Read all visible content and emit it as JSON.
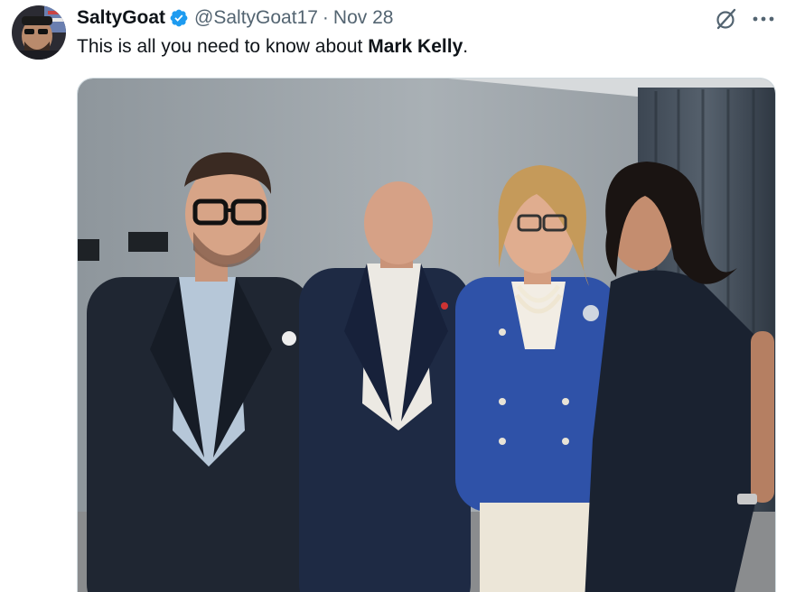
{
  "tweet": {
    "display_name": "SaltyGoat",
    "handle": "@SaltyGoat17",
    "separator": "·",
    "date": "Nov 28",
    "text_prefix": "This is all you need to know about ",
    "text_bold": "Mark Kelly",
    "text_suffix": "."
  },
  "icons": {
    "verified": "verified-badge-icon",
    "grok": "grok-icon",
    "more": "more-icon"
  },
  "colors": {
    "verified_blue": "#1d9bf0",
    "secondary_text": "#536471",
    "primary_text": "#0f1419"
  }
}
